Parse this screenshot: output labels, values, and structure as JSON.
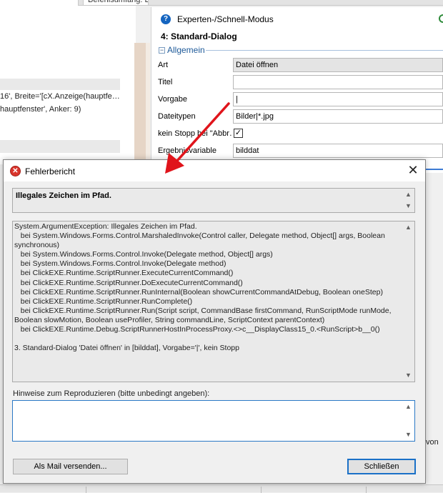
{
  "background": {
    "tab_label": "Befehlsumfang: Experte",
    "code_lines": [
      "16', Breite='[cX.Anzeige(hauptfe…",
      "hauptfenster', Anker: 9)"
    ],
    "panel": {
      "mode_label": "Experten-/Schnell-Modus",
      "dialog_title": "4: Standard-Dialog",
      "section": "Allgemein",
      "properties": [
        {
          "label": "Art",
          "value": "Datei öffnen"
        },
        {
          "label": "Titel",
          "value": ""
        },
        {
          "label": "Vorgabe",
          "value": "|"
        },
        {
          "label": "Dateitypen",
          "value": "Bilder|*.jpg"
        },
        {
          "label": "kein Stopp bei \"Abbr…",
          "value": "✓"
        },
        {
          "label": "Ergebnisvariable",
          "value": "bilddat"
        }
      ]
    },
    "right_fragment": "von"
  },
  "dialog": {
    "title": "Fehlerbericht",
    "close_glyph": "✕",
    "message": "Illegales Zeichen im Pfad.",
    "details": [
      "System.ArgumentException: Illegales Zeichen im Pfad.",
      "   bei System.Windows.Forms.Control.MarshaledInvoke(Control caller, Delegate method, Object[] args, Boolean",
      "synchronous)",
      "   bei System.Windows.Forms.Control.Invoke(Delegate method, Object[] args)",
      "   bei System.Windows.Forms.Control.Invoke(Delegate method)",
      "   bei ClickEXE.Runtime.ScriptRunner.ExecuteCurrentCommand()",
      "   bei ClickEXE.Runtime.ScriptRunner.DoExecuteCurrentCommand()",
      "   bei ClickEXE.Runtime.ScriptRunner.RunInternal(Boolean showCurrentCommandAtDebug, Boolean oneStep)",
      "   bei ClickEXE.Runtime.ScriptRunner.RunComplete()",
      "   bei ClickEXE.Runtime.ScriptRunner.Run(Script script, CommandBase firstCommand, RunScriptMode runMode,",
      "Boolean slowMotion, Boolean useProfiler, String commandLine, ScriptContext parentContext)",
      "   bei ClickEXE.Runtime.Debug.ScriptRunnerHostInProcessProxy.<>c__DisplayClass15_0.<RunScript>b__0()",
      "",
      "3. Standard-Dialog 'Datei öffnen' in [bilddat], Vorgabe='|', kein Stopp"
    ],
    "repro_label": "Hinweise zum Reproduzieren (bitte unbedingt angeben):",
    "repro_value": "",
    "mail_button": "Als Mail versenden...",
    "close_button": "Schließen"
  }
}
